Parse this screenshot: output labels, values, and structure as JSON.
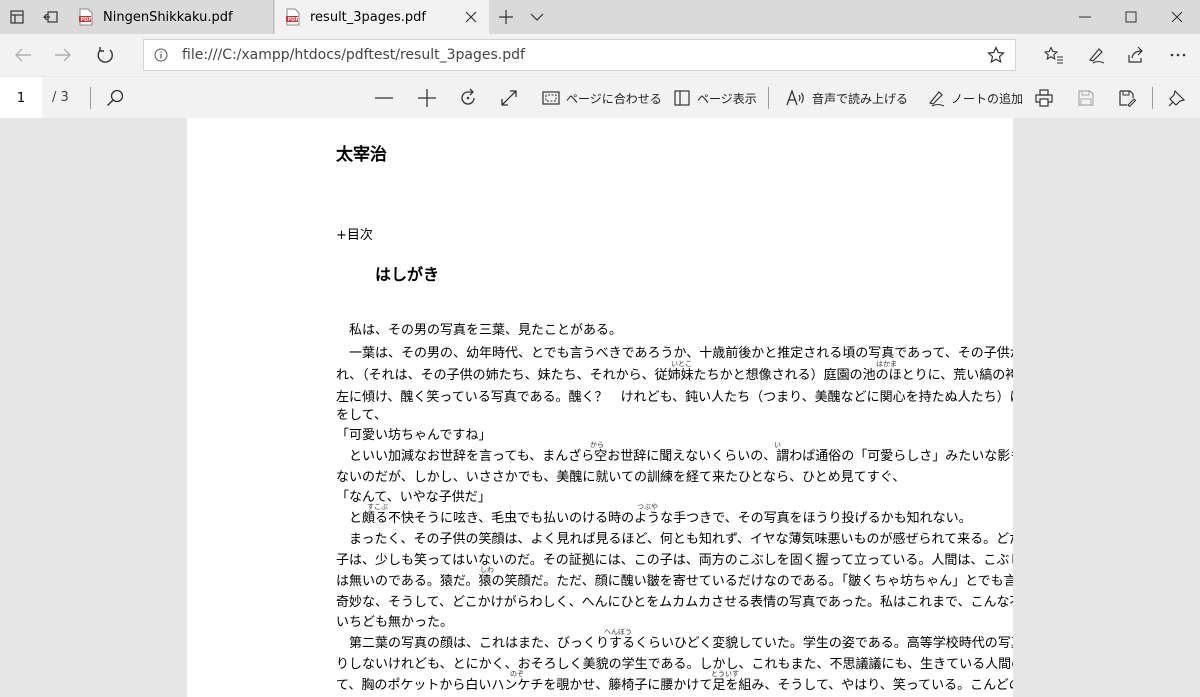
{
  "browser": {
    "tabs": [
      {
        "label": "NingenShikkaku.pdf",
        "active": false
      },
      {
        "label": "result_3pages.pdf",
        "active": true
      }
    ],
    "address": "file:///C:/xampp/htdocs/pdftest/result_3pages.pdf"
  },
  "pdf_toolbar": {
    "page_current": "1",
    "page_total": "/ 3",
    "fit_page_label": "ページに合わせる",
    "page_view_label": "ページ表示",
    "read_aloud_label": "音声で読み上げる",
    "add_notes_label": "ノートの追加"
  },
  "document": {
    "title": "太宰治",
    "toc": "+目次",
    "section": "はしがき",
    "lines": [
      "　私は、その男の写真を三葉、見たことがある。",
      "　一葉は、その男の、幼年時代、とでも言うべきであろうか、十歳前後かと推定される頃の写真であって、その子供が",
      "れ、（それは、その子供の姉たち、妹たち、それから、従姉妹たちかと想像される）庭園の池のほとりに、荒い縞の袴",
      "左に傾け、醜く笑っている写真である。醜く？　けれども、鈍い人たち（つまり、美醜などに関心を持たぬ人たち）は",
      "をして、",
      "「可愛い坊ちゃんですね」",
      "　といい加減なお世辞を言っても、まんざら空お世辞に聞えないくらいの、謂わば通俗の「可愛らしさ」みたいな影も",
      "ないのだが、しかし、いささかでも、美醜に就いての訓練を経て来たひとなら、ひとめ見てすぐ、",
      "「なんて、いやな子供だ」",
      "　と頗る不快そうに呟き、毛虫でも払いのける時のような手つきで、その写真をほうり投げるかも知れない。",
      "　まったく、その子供の笑顔は、よく見れば見るほど、何とも知れず、イヤな薄気味悪いものが感ぜられて来る。どだ",
      "子は、少しも笑ってはいないのだ。その証拠には、この子は、両方のこぶしを固く握って立っている。人間は、こぶし",
      "は無いのである。猿だ。猿の笑顔だ。ただ、顔に醜い皺を寄せているだけなのである。「皺くちゃ坊ちゃん」とでも言",
      "奇妙な、そうして、どこかけがらわしく、へんにひとをムカムカさせる表情の写真であった。私はこれまで、こんな不",
      "いちども無かった。",
      "　第二葉の写真の顔は、これはまた、びっくりするくらいひどく変貌していた。学生の姿である。高等学校時代の写真",
      "りしないけれども、とにかく、おそろしく美貌の学生である。しかし、これもまた、不思議議にも、生きている人間の感",
      "て、胸のポケットから白いハンケチを覗かせ、籐椅子に腰かけて足を組み、そうして、やはり、笑っている。こんどの"
    ],
    "furigana": [
      {
        "text": "いとこ",
        "line": 2
      },
      {
        "text": "はかま",
        "line": 2
      },
      {
        "text": "から",
        "line": 6
      },
      {
        "text": "い",
        "line": 6
      },
      {
        "text": "すこぶ",
        "line": 9
      },
      {
        "text": "つぶや",
        "line": 9
      },
      {
        "text": "しわ",
        "line": 12
      },
      {
        "text": "へんぼう",
        "line": 15
      },
      {
        "text": "のぞ",
        "line": 17
      },
      {
        "text": "とういす",
        "line": 17
      }
    ]
  }
}
